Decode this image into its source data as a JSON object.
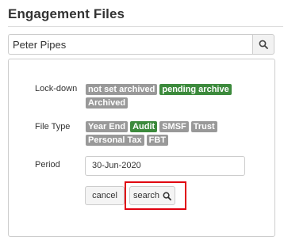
{
  "title": "Engagement Files",
  "search": {
    "value": "Peter Pipes"
  },
  "filters": {
    "lockdown": {
      "label": "Lock-down",
      "tags": [
        {
          "text": "not set archived",
          "active": false
        },
        {
          "text": "pending archive",
          "active": true
        },
        {
          "text": "Archived",
          "active": false
        }
      ]
    },
    "filetype": {
      "label": "File Type",
      "tags": [
        {
          "text": "Year End",
          "active": false
        },
        {
          "text": "Audit",
          "active": true
        },
        {
          "text": "SMSF",
          "active": false
        },
        {
          "text": "Trust",
          "active": false
        },
        {
          "text": "Personal Tax",
          "active": false
        },
        {
          "text": "FBT",
          "active": false
        }
      ]
    },
    "period": {
      "label": "Period",
      "value": "30-Jun-2020"
    }
  },
  "buttons": {
    "cancel": "cancel",
    "search": "search"
  },
  "colors": {
    "tag_default": "#999999",
    "tag_active": "#3c8a3c",
    "highlight": "#e0000f"
  },
  "icons": {
    "search": "search-icon"
  }
}
